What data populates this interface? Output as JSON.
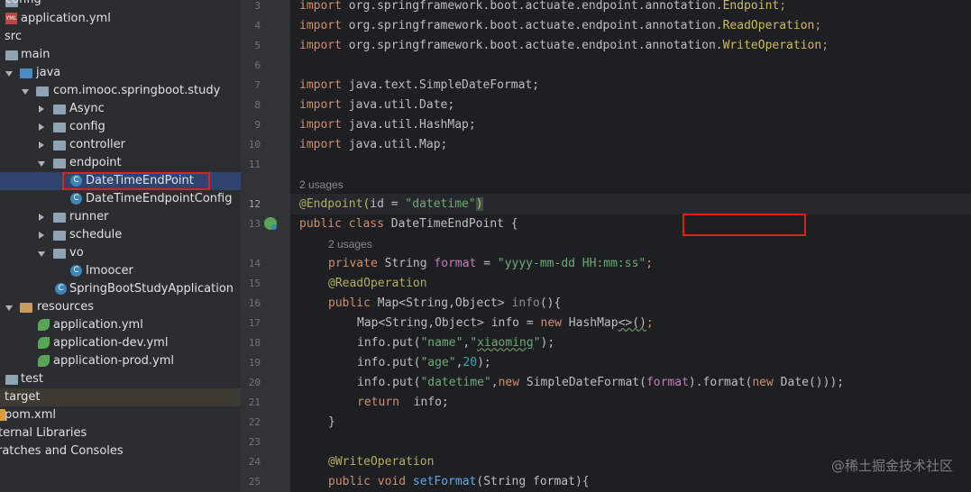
{
  "tree": {
    "items": [
      {
        "label": "config"
      },
      {
        "label": "application.yml"
      },
      {
        "label": "src"
      },
      {
        "label": "main"
      },
      {
        "label": "java"
      },
      {
        "label": "com.imooc.springboot.study"
      },
      {
        "label": "Async"
      },
      {
        "label": "config"
      },
      {
        "label": "controller"
      },
      {
        "label": "endpoint"
      },
      {
        "label": "DateTimeEndPoint"
      },
      {
        "label": "DateTimeEndpointConfig"
      },
      {
        "label": "runner"
      },
      {
        "label": "schedule"
      },
      {
        "label": "vo"
      },
      {
        "label": "Imoocer"
      },
      {
        "label": "SpringBootStudyApplication"
      },
      {
        "label": "resources"
      },
      {
        "label": "application.yml"
      },
      {
        "label": "application-dev.yml"
      },
      {
        "label": "application-prod.yml"
      },
      {
        "label": "test"
      },
      {
        "label": "target"
      },
      {
        "label": "pom.xml"
      },
      {
        "label": "ternal Libraries"
      },
      {
        "label": "ratches and Consoles"
      }
    ],
    "file_badge": "YML",
    "class_badge": "C"
  },
  "gutter": {
    "lines": [
      "3",
      "4",
      "5",
      "6",
      "7",
      "8",
      "9",
      "10",
      "11",
      "12",
      "13",
      "14",
      "15",
      "16",
      "17",
      "18",
      "19",
      "20",
      "21",
      "22",
      "23",
      "24",
      "25"
    ]
  },
  "editor": {
    "usages_1": "2 usages",
    "usages_2": "2 usages",
    "l3": {
      "kw": "import",
      "pkg": " org.springframework.boot.actuate.endpoint.annotation.",
      "cls": "Endpoint",
      "end": ";"
    },
    "l4": {
      "kw": "import",
      "pkg": " org.springframework.boot.actuate.endpoint.annotation.",
      "cls": "ReadOperation",
      "end": ";"
    },
    "l5": {
      "kw": "import",
      "pkg": " org.springframework.boot.actuate.endpoint.annotation.",
      "cls": "WriteOperation",
      "end": ";"
    },
    "l7": {
      "kw": "import",
      "rest": " java.text.SimpleDateFormat;"
    },
    "l8": {
      "kw": "import",
      "rest": " java.util.Date;"
    },
    "l9": {
      "kw": "import",
      "rest": " java.util.HashMap;"
    },
    "l10": {
      "kw": "import",
      "rest": " java.util.Map;"
    },
    "l12": {
      "ann": "@Endpoint",
      "p1": "(",
      "arg": "id = ",
      "str": "\"datetime\"",
      "p2": ")"
    },
    "l13": {
      "kw": "public class ",
      "name": "DateTimeEndPoint",
      "rest": " {"
    },
    "l14": {
      "kw": "private ",
      "type": "String ",
      "field": "format",
      "eq": " = ",
      "str": "\"yyyy-mm-dd HH:mm:ss\"",
      "end": ";"
    },
    "l15": {
      "ann": "@ReadOperation"
    },
    "l16": {
      "kw": "public ",
      "rest": "Map<String,Object> ",
      "method": "info",
      "end": "(){"
    },
    "l17": {
      "a": "Map<String,Object> info = ",
      "kw": "new",
      "b": " HashMap",
      "c": "<>()",
      "d": ";"
    },
    "l18": {
      "a": "info.put(",
      "s1": "\"name\"",
      "c": ",",
      "s2": "\"",
      "s2w": "xiaoming",
      "s2e": "\"",
      "d": ");"
    },
    "l19": {
      "a": "info.put(",
      "s1": "\"age\"",
      "c": ",",
      "n": "20",
      "d": ");"
    },
    "l20": {
      "a": "info.put(",
      "s1": "\"datetime\"",
      "c": ",",
      "kw": "new",
      "b": " SimpleDateFormat(",
      "field": "format",
      "e": ").format(",
      "kw2": "new",
      "f": " Date()));"
    },
    "l21": {
      "kw": "return",
      "rest": "  info;"
    },
    "l22": {
      "text": "}"
    },
    "l24": {
      "ann": "@WriteOperation"
    },
    "l25": {
      "kw": "public void ",
      "method": "setFormat",
      "rest": "(String format){"
    }
  },
  "watermark": "@稀土掘金技术社区",
  "colors": {
    "keyword": "#cf8e6d",
    "string": "#6aab73",
    "annotation": "#b3ae60",
    "field": "#c77dbb",
    "number": "#2aacb8",
    "highlight_box": "#e0201a",
    "selection": "#2e436e"
  }
}
